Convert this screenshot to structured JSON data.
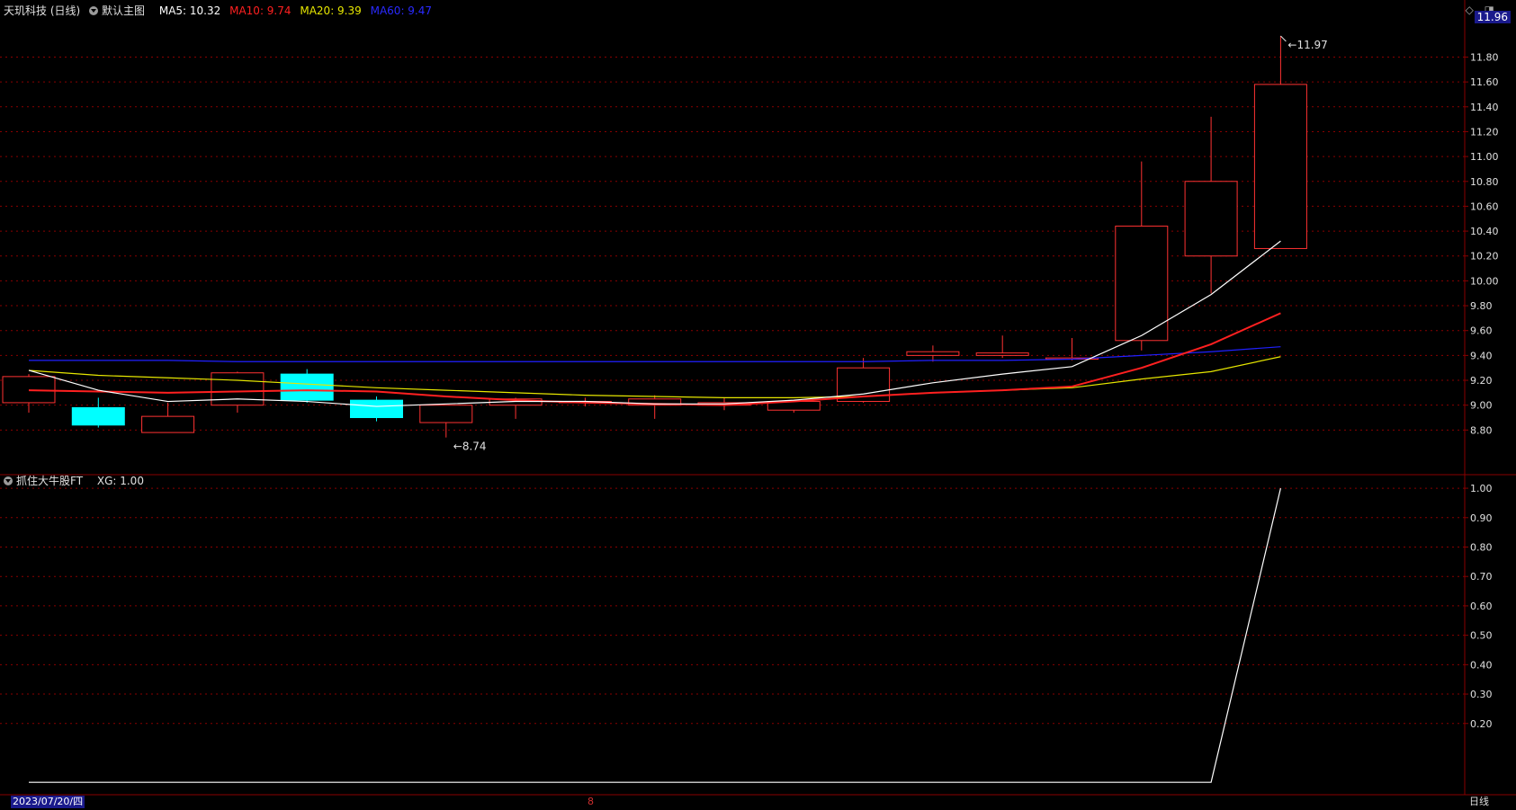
{
  "header": {
    "stock_name": "天玑科技 (日线)",
    "main_chart_label": "默认主图",
    "ma5": "MA5: 10.32",
    "ma10": "MA10: 9.74",
    "ma20": "MA20: 9.39",
    "ma60": "MA60: 9.47"
  },
  "indicator_header": {
    "name": "抓住大牛股FT",
    "value": "XG: 1.00"
  },
  "top_icons": {
    "diamond": "◇",
    "toggle": "◨"
  },
  "current_price": "11.96",
  "footer": {
    "date": "2023/07/20/四",
    "month": "8",
    "period": "日线"
  },
  "colors": {
    "up": "#ff3232",
    "down": "#00ffff",
    "ma5": "#ffffff",
    "ma10": "#ff2020",
    "ma20": "#e6e600",
    "ma60": "#2020ff",
    "grid": "#8a0000",
    "axis_text": "#e0e0e0"
  },
  "chart_data": [
    {
      "type": "candlestick",
      "y_ticks": [
        "11.80",
        "11.60",
        "11.40",
        "11.20",
        "11.00",
        "10.80",
        "10.60",
        "10.40",
        "10.20",
        "10.00",
        "9.80",
        "9.60",
        "9.40",
        "9.20",
        "9.00",
        "8.80"
      ],
      "ylim": [
        8.6,
        12.1
      ],
      "candles": [
        {
          "o": 9.02,
          "h": 9.25,
          "l": 8.94,
          "c": 9.23
        },
        {
          "o": 8.98,
          "h": 9.06,
          "l": 8.82,
          "c": 8.84
        },
        {
          "o": 8.78,
          "h": 9.02,
          "l": 8.78,
          "c": 8.91
        },
        {
          "o": 9.0,
          "h": 9.27,
          "l": 8.94,
          "c": 9.26
        },
        {
          "o": 9.25,
          "h": 9.29,
          "l": 9.02,
          "c": 9.04
        },
        {
          "o": 9.04,
          "h": 9.07,
          "l": 8.87,
          "c": 8.9
        },
        {
          "o": 8.86,
          "h": 9.0,
          "l": 8.74,
          "c": 9.0
        },
        {
          "o": 9.0,
          "h": 9.06,
          "l": 8.89,
          "c": 9.05
        },
        {
          "o": 9.02,
          "h": 9.06,
          "l": 8.99,
          "c": 9.03
        },
        {
          "o": 9.0,
          "h": 9.08,
          "l": 8.89,
          "c": 9.05
        },
        {
          "o": 9.0,
          "h": 9.06,
          "l": 8.96,
          "c": 9.02
        },
        {
          "o": 8.96,
          "h": 9.04,
          "l": 8.94,
          "c": 9.03
        },
        {
          "o": 9.03,
          "h": 9.38,
          "l": 9.02,
          "c": 9.3
        },
        {
          "o": 9.4,
          "h": 9.48,
          "l": 9.35,
          "c": 9.43
        },
        {
          "o": 9.4,
          "h": 9.56,
          "l": 9.38,
          "c": 9.42
        },
        {
          "o": 9.37,
          "h": 9.54,
          "l": 9.36,
          "c": 9.38
        },
        {
          "o": 9.52,
          "h": 10.96,
          "l": 9.44,
          "c": 10.44
        },
        {
          "o": 10.2,
          "h": 11.32,
          "l": 9.9,
          "c": 10.8
        },
        {
          "o": 10.26,
          "h": 11.97,
          "l": 10.26,
          "c": 11.58
        }
      ],
      "ma5": [
        9.28,
        9.12,
        9.03,
        9.05,
        9.03,
        8.99,
        9.01,
        9.03,
        9.03,
        9.01,
        9.01,
        9.04,
        9.09,
        9.18,
        9.25,
        9.31,
        9.56,
        9.89,
        10.32
      ],
      "ma10": [
        9.12,
        9.11,
        9.1,
        9.11,
        9.12,
        9.11,
        9.07,
        9.04,
        9.02,
        9.01,
        9.0,
        9.03,
        9.07,
        9.1,
        9.12,
        9.15,
        9.3,
        9.49,
        9.74
      ],
      "ma20": [
        9.28,
        9.24,
        9.22,
        9.2,
        9.17,
        9.14,
        9.12,
        9.1,
        9.08,
        9.07,
        9.06,
        9.06,
        9.07,
        9.1,
        9.12,
        9.14,
        9.21,
        9.27,
        9.39
      ],
      "ma60": [
        9.36,
        9.36,
        9.36,
        9.35,
        9.35,
        9.35,
        9.35,
        9.35,
        9.35,
        9.35,
        9.35,
        9.35,
        9.35,
        9.36,
        9.36,
        9.37,
        9.4,
        9.43,
        9.47
      ],
      "annotations": [
        {
          "label": "11.97",
          "index": 18,
          "value": 11.97
        },
        {
          "label": "8.74",
          "index": 6,
          "value": 8.74
        }
      ]
    },
    {
      "type": "line",
      "y_ticks": [
        "1.00",
        "0.90",
        "0.80",
        "0.70",
        "0.60",
        "0.50",
        "0.40",
        "0.30",
        "0.20"
      ],
      "ylim": [
        -0.03,
        1.04
      ],
      "values": [
        0,
        0,
        0,
        0,
        0,
        0,
        0,
        0,
        0,
        0,
        0,
        0,
        0,
        0,
        0,
        0,
        0,
        0,
        1
      ]
    }
  ]
}
